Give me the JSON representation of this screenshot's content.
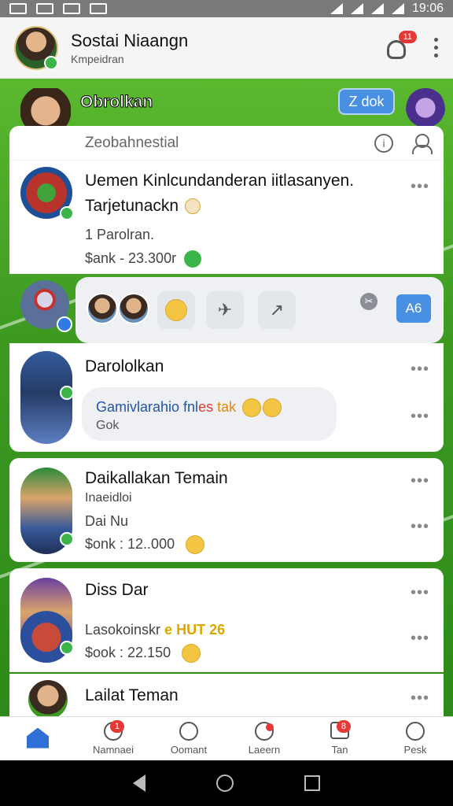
{
  "status_bar": {
    "time": "19:06"
  },
  "header": {
    "title": "Sostai Niaangn",
    "subtitle": "Kmpeidran",
    "notif_count": "11"
  },
  "banner": {
    "chat_label": "Obrolkan",
    "compose_label": "Z dok"
  },
  "search": {
    "label": "Zeobahnestial",
    "info_icon": "i"
  },
  "cards": [
    {
      "title": "Uemen Kinlcundanderan iitlasanyen.",
      "title2": "Tarjetunackn",
      "line1": "1 Parolran.",
      "line2": "$ank - 23.300r"
    },
    {
      "title": "Darololkan",
      "msg_main": "Gamivlarahio fnl",
      "msg_red": "es",
      "msg_orange": "tak",
      "msg_sub": "Gok"
    },
    {
      "title": "Daikallakan Temain",
      "line1": "Inaeidloi",
      "line2": "Dai Nu",
      "line3": "$onk : 12..000"
    },
    {
      "title": "Diss Dar",
      "line1": "Lasokoinskr",
      "line1_gold": "e HUT 26",
      "line2": "$ook : 22.150"
    },
    {
      "title": "Lailat Teman"
    }
  ],
  "reactions": {
    "ab_label": "A6",
    "cross": "✂"
  },
  "bottom_nav": [
    {
      "label": "",
      "icon": "home-icon"
    },
    {
      "label": "Namnaei",
      "icon": "search-icon",
      "badge": "1"
    },
    {
      "label": "Oomant",
      "icon": "chat-icon"
    },
    {
      "label": "Laeern",
      "icon": "people-icon"
    },
    {
      "label": "Tan",
      "icon": "inbox-icon",
      "badge": "8"
    },
    {
      "label": "Pesk",
      "icon": "profile-icon"
    }
  ],
  "colors": {
    "accent": "#4a90e2",
    "online": "#3bb54a",
    "badge": "#e53935",
    "field": "#3c9a21"
  }
}
